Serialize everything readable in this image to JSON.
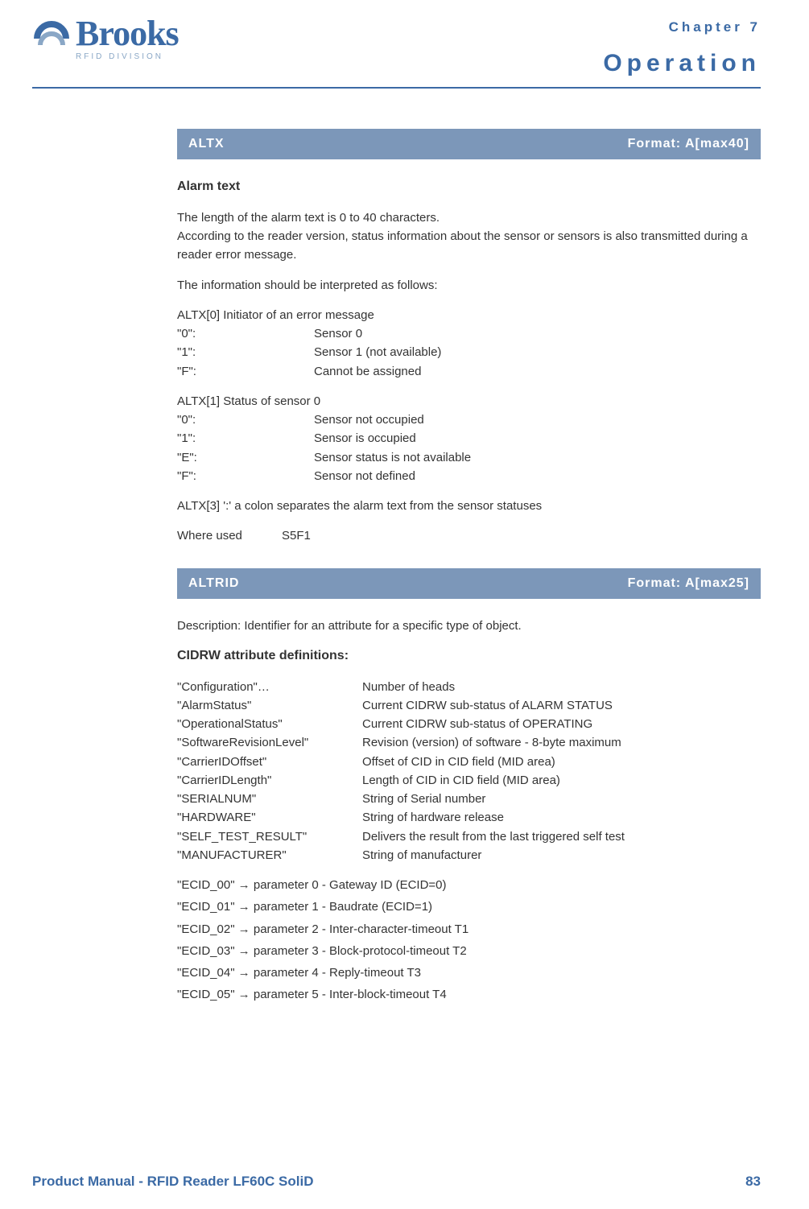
{
  "header": {
    "brand": "Brooks",
    "division": "RFID DIVISION",
    "chapter_label": "Chapter 7",
    "chapter_title": "Operation"
  },
  "section1": {
    "bar_left": "ALTX",
    "bar_right": "Format: A[max40]",
    "heading": "Alarm text",
    "p1": "The length of the alarm text is 0 to 40 characters.",
    "p2": "According to the reader version, status information about the sensor or sensors is also transmitted during a reader error message.",
    "p3": "The information should be interpreted as follows:",
    "altx0_head": "ALTX[0] Initiator of an error message",
    "altx0": [
      {
        "k": "\"0\":",
        "v": "Sensor 0"
      },
      {
        "k": "\"1\":",
        "v": "Sensor 1 (not available)"
      },
      {
        "k": "\"F\":",
        "v": "Cannot be assigned"
      }
    ],
    "altx1_head": "ALTX[1] Status of sensor 0",
    "altx1": [
      {
        "k": "\"0\":",
        "v": "Sensor not occupied"
      },
      {
        "k": "\"1\":",
        "v": "Sensor is occupied"
      },
      {
        "k": "\"E\":",
        "v": "Sensor status is not available"
      },
      {
        "k": "\"F\":",
        "v": "Sensor not defined"
      }
    ],
    "altx3": "ALTX[3] ':' a colon separates the alarm text from the sensor statuses",
    "where_used_k": "Where used",
    "where_used_v": "S5F1"
  },
  "section2": {
    "bar_left": "ALTRID",
    "bar_right": "Format: A[max25]",
    "desc": "Description: Identifier for an attribute for a specific type of object.",
    "heading": "CIDRW attribute definitions:",
    "defs": [
      {
        "k": "\"Configuration\"…",
        "v": "Number of heads"
      },
      {
        "k": "\"AlarmStatus\"",
        "v": "Current CIDRW sub-status of ALARM STATUS"
      },
      {
        "k": "\"OperationalStatus\"",
        "v": "Current CIDRW sub-status of OPERATING"
      },
      {
        "k": "\"SoftwareRevisionLevel\"",
        "v": "Revision (version) of software - 8-byte maximum"
      },
      {
        "k": "\"CarrierIDOffset\"",
        "v": "Offset of CID in CID field (MID area)"
      },
      {
        "k": "\"CarrierIDLength\"",
        "v": "Length of CID in CID field (MID area)"
      },
      {
        "k": "\"SERIALNUM\"",
        "v": "String of Serial number"
      },
      {
        "k": "\"HARDWARE\"",
        "v": "String of hardware release"
      },
      {
        "k": "\"SELF_TEST_RESULT\"",
        "v": "Delivers the result from the last triggered self test"
      },
      {
        "k": "\"MANUFACTURER\"",
        "v": "String of manufacturer"
      }
    ],
    "ecid": [
      "\"ECID_00\" → parameter 0 - Gateway ID (ECID=0)",
      "\"ECID_01\" → parameter 1 - Baudrate (ECID=1)",
      "\"ECID_02\" → parameter 2 - Inter-character-timeout T1",
      "\"ECID_03\" → parameter 3 - Block-protocol-timeout T2",
      "\"ECID_04\" → parameter 4 - Reply-timeout T3",
      "\"ECID_05\" → parameter 5 - Inter-block-timeout T4"
    ]
  },
  "footer": {
    "left": "Product Manual - RFID Reader LF60C SoliD",
    "right": "83"
  }
}
